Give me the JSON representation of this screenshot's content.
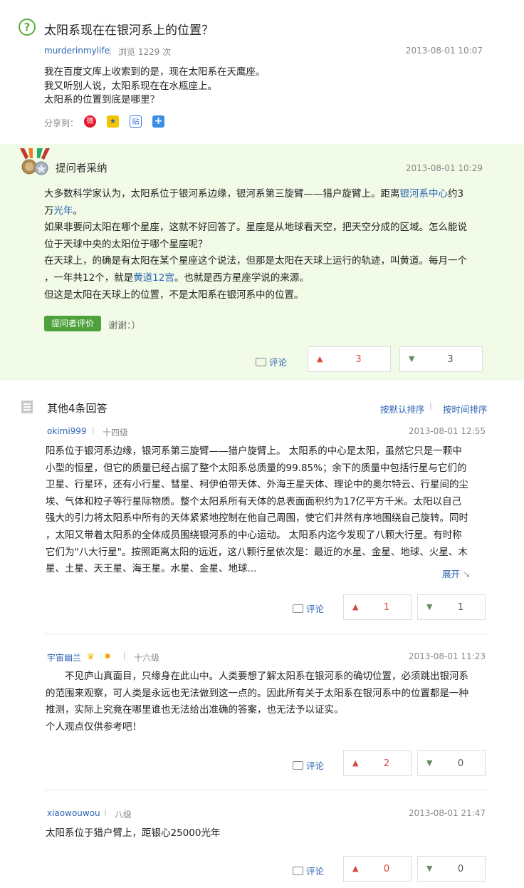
{
  "question": {
    "title": "太阳系现在在银河系上的位置？",
    "user": "murderinmylife",
    "views": "浏览 1229 次",
    "time": "2013-08-01 10:07",
    "body_lines": [
      "我在百度文库上收索到的是，现在太阳系在天鹰座。",
      "我又听别人说，太阳系现在在水瓶座上。",
      "太阳系的位置到底是哪里？"
    ],
    "share_label": "分享到："
  },
  "best_answer": {
    "label": "提问者采纳",
    "time": "2013-08-01 10:29",
    "lines": [
      [
        "大多数科学家认为，太阳系位于银河系边缘，银河系第三旋臂——猎户旋臂上。距离",
        "银河系中心",
        "约3"
      ],
      [
        "万",
        "光年",
        "。"
      ],
      [
        "如果非要问太阳在哪个星座，这就不好回答了。星座是从地球看天空，把天空分成的区域。怎么能说"
      ],
      [
        "位于天球中央的太阳位于哪个星座呢？"
      ],
      [
        "在天球上，的确是有太阳在某个星座这个说法，但那是太阳在天球上运行的轨迹，叫黄道。每月一个"
      ],
      [
        "，一年共12个，就是",
        "黄道12宫",
        "。也就是西方星座学说的来源。"
      ],
      [
        "但这是太阳在天球上的位置，不是太阳系在银河系中的位置。"
      ]
    ],
    "eval_button": "提问者评价",
    "eval_text": "谢谢：）",
    "comment_label": "评论",
    "up_count": "3",
    "down_count": "3"
  },
  "others": {
    "title": "其他4条回答",
    "sort_default": "按默认排序",
    "sort_time": "按时间排序",
    "answers": [
      {
        "user": "okimi999",
        "level": "十四级",
        "time": "2013-08-01 12:55",
        "lines": [
          "阳系位于银河系边缘，银河系第三旋臂——猎户旋臂上。 太阳系的中心是太阳，虽然它只是一颗中",
          "小型的恒星，但它的质量已经占据了整个太阳系总质量的99.85%；余下的质量中包括行星与它们的",
          "卫星、行星环，还有小行星、彗星、柯伊伯带天体、外海王星天体、理论中的奥尔特云、行星间的尘",
          "埃、气体和粒子等行星际物质。整个太阳系所有天体的总表面面积约为17亿平方千米。太阳以自己",
          "强大的引力将太阳系中所有的天体紧紧地控制在他自己周围，使它们井然有序地围绕自己旋转。同时",
          "，太阳又带着太阳系的全体成员围绕银河系的中心运动。 太阳系内迄今发现了八颗大行星。有时称",
          "它们为\"八大行星\"。按照距离太阳的远近，这八颗行星依次是：最近的水星、金星、地球、火星、木",
          "星、土星、天王星、海王星。水星、金星、地球..."
        ],
        "expand": "展开",
        "comment_label": "评论",
        "up_count": "1",
        "down_count": "1"
      },
      {
        "user": "宇宙幽兰",
        "level": "十六级",
        "time": "2013-08-01 11:23",
        "lines": [
          "　　不见庐山真面目，只缘身在此山中。人类要想了解太阳系在银河系的确切位置，必须跳出银河系",
          "的范围来观察，可人类是永远也无法做到这一点的。因此所有关于太阳系在银河系中的位置都是一种",
          "推测，实际上究竟在哪里谁也无法给出准确的答案，也无法予以证实。",
          "个人观点仅供参考吧！"
        ],
        "comment_label": "评论",
        "up_count": "2",
        "down_count": "0"
      },
      {
        "user": "xiaowouwou",
        "level": "八级",
        "time": "2013-08-01 21:47",
        "lines": [
          "太阳系位于猎户臂上，距银心25000光年"
        ],
        "comment_label": "评论",
        "up_count": "0",
        "down_count": "0"
      }
    ]
  },
  "colors": {
    "green": "#4ea13b",
    "link": "#2d64b3",
    "best_bg": "#f1fbe7",
    "up": "#d9463c"
  }
}
